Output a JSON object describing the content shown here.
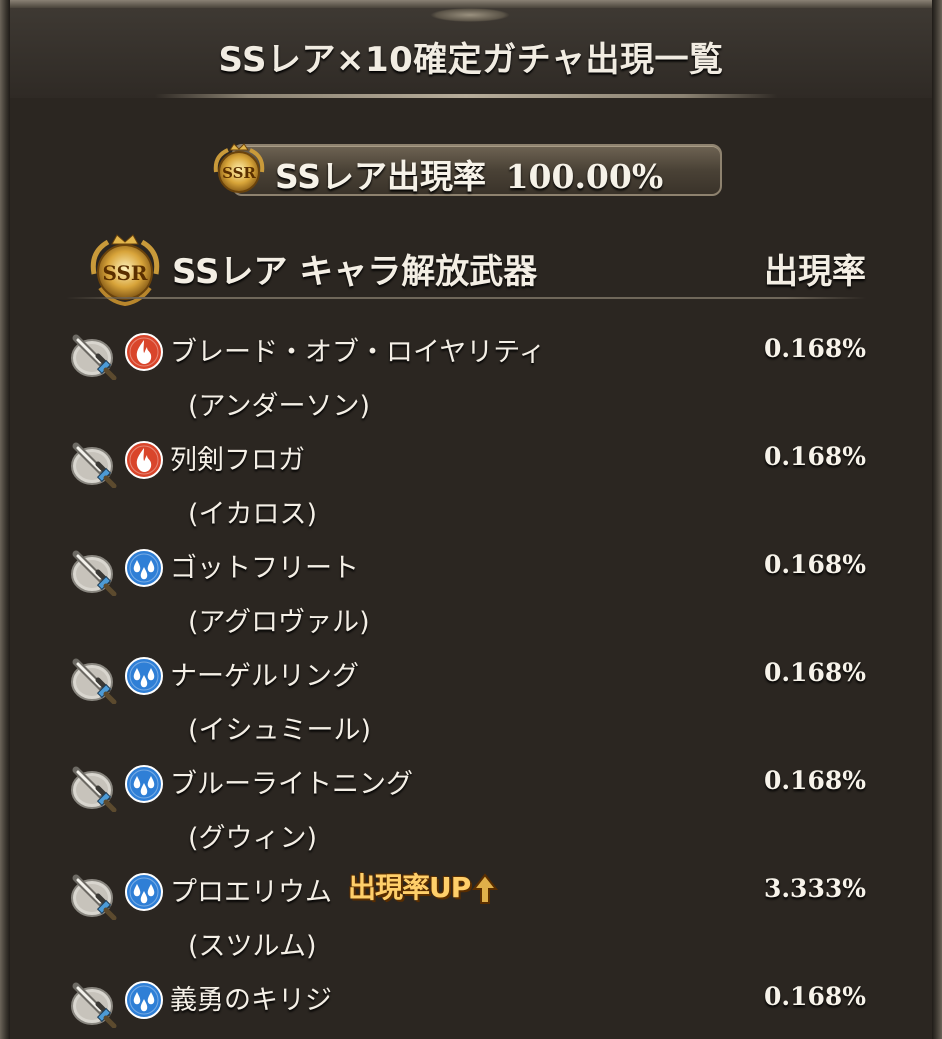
{
  "title": "SSレア×10確定ガチャ出現一覧",
  "rate_banner": {
    "label": "SSレア出現率",
    "value": "100.00%"
  },
  "badge_text": "SSR",
  "section": {
    "title": "SSレア キャラ解放武器",
    "rate_header": "出現率"
  },
  "up_label": "出現率UP",
  "colors": {
    "fire": "#d9452b",
    "water": "#2f7fd6",
    "gold": "#e0b04a"
  },
  "items": [
    {
      "weapon": "ブレード・オブ・ロイヤリティ",
      "character": "(アンダーソン)",
      "element": "fire",
      "rate": "0.168%",
      "rate_up": false
    },
    {
      "weapon": "列剣フロガ",
      "character": "(イカロス)",
      "element": "fire",
      "rate": "0.168%",
      "rate_up": false
    },
    {
      "weapon": "ゴットフリート",
      "character": "(アグロヴァル)",
      "element": "water",
      "rate": "0.168%",
      "rate_up": false
    },
    {
      "weapon": "ナーゲルリング",
      "character": "(イシュミール)",
      "element": "water",
      "rate": "0.168%",
      "rate_up": false
    },
    {
      "weapon": "ブルーライトニング",
      "character": "(グウィン)",
      "element": "water",
      "rate": "0.168%",
      "rate_up": false
    },
    {
      "weapon": "プロエリウム",
      "character": "(スツルム)",
      "element": "water",
      "rate": "3.333%",
      "rate_up": true
    },
    {
      "weapon": "義勇のキリジ",
      "character": "",
      "element": "water",
      "rate": "0.168%",
      "rate_up": false
    }
  ]
}
